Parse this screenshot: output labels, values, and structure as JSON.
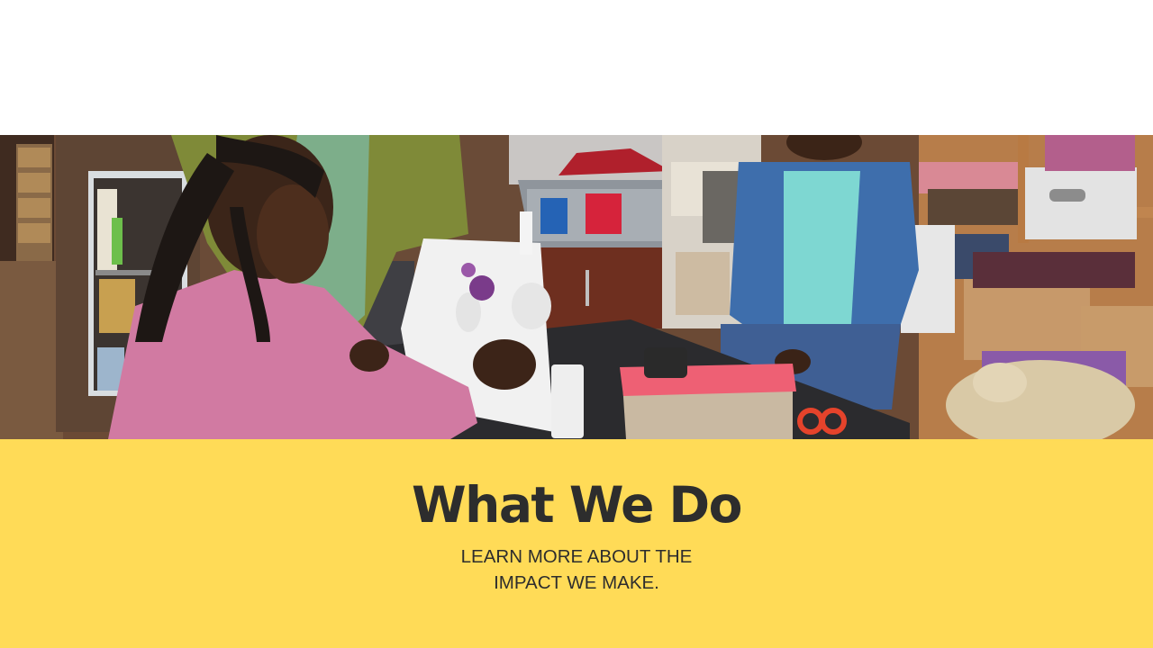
{
  "hero_image": {
    "description_icon": "workshop-photo",
    "colors": {
      "panel_background": "#ffdb57",
      "heading_text": "#2d2d2d"
    }
  },
  "section": {
    "title": "What We Do",
    "subtitle": "LEARN MORE ABOUT THE IMPACT WE MAKE."
  }
}
